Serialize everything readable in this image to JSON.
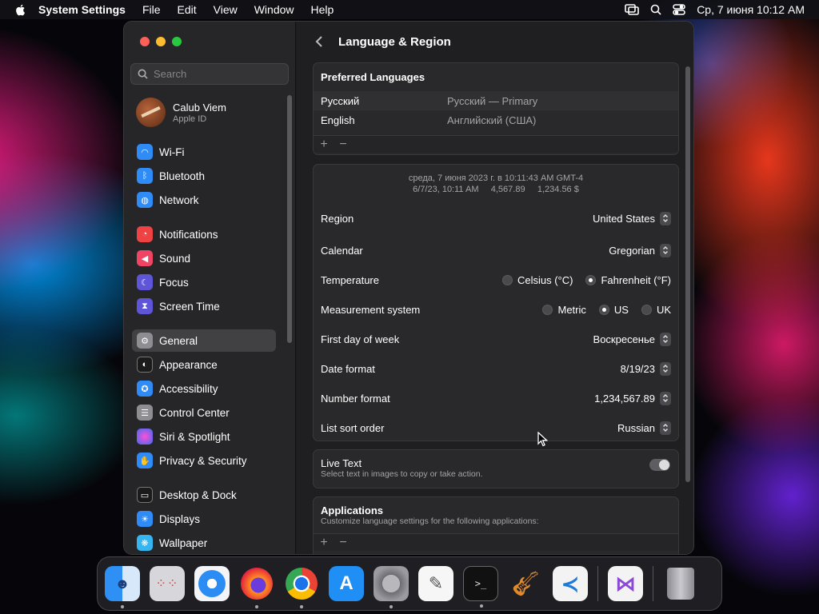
{
  "menubar": {
    "app": "System Settings",
    "menus": [
      "File",
      "Edit",
      "View",
      "Window",
      "Help"
    ],
    "clock": "Ср, 7 июня  10:12 AM"
  },
  "sidebar": {
    "search_placeholder": "Search",
    "profile": {
      "name": "Calub Viem",
      "subtitle": "Apple ID"
    },
    "items": [
      {
        "label": "Wi-Fi",
        "icon": "wifi-icon",
        "color": "#2f8cf6"
      },
      {
        "label": "Bluetooth",
        "icon": "bluetooth-icon",
        "color": "#2f8cf6"
      },
      {
        "label": "Network",
        "icon": "globe-icon",
        "color": "#2f8cf6"
      },
      {
        "label": "Notifications",
        "icon": "bell-icon",
        "color": "#ef4343"
      },
      {
        "label": "Sound",
        "icon": "speaker-icon",
        "color": "#ef4463"
      },
      {
        "label": "Focus",
        "icon": "moon-icon",
        "color": "#5e55d8"
      },
      {
        "label": "Screen Time",
        "icon": "hourglass-icon",
        "color": "#5e55d8"
      },
      {
        "label": "General",
        "icon": "gear-icon",
        "color": "#8d8d92"
      },
      {
        "label": "Appearance",
        "icon": "appearance-icon",
        "color": "#1b1b1b"
      },
      {
        "label": "Accessibility",
        "icon": "accessibility-icon",
        "color": "#2f8cf6"
      },
      {
        "label": "Control Center",
        "icon": "control-center-icon",
        "color": "#8d8d92"
      },
      {
        "label": "Siri & Spotlight",
        "icon": "siri-icon",
        "color": "#c04fd8"
      },
      {
        "label": "Privacy & Security",
        "icon": "hand-icon",
        "color": "#2f8cf6"
      },
      {
        "label": "Desktop & Dock",
        "icon": "dock-icon",
        "color": "#1b1b1b"
      },
      {
        "label": "Displays",
        "icon": "sun-icon",
        "color": "#2f8cf6"
      },
      {
        "label": "Wallpaper",
        "icon": "wallpaper-icon",
        "color": "#35b6f0"
      }
    ]
  },
  "content": {
    "title": "Language & Region",
    "preferred": {
      "header": "Preferred Languages",
      "languages": [
        {
          "name": "Русский",
          "value": "Русский — Primary"
        },
        {
          "name": "English",
          "value": "Английский (США)"
        }
      ],
      "add": "+",
      "remove": "−"
    },
    "preview": {
      "line1": "среда, 7 июня 2023 г. в 10:11:43 AM GMT-4",
      "line2": "6/7/23, 10:11 AM     4,567.89     1,234.56 $"
    },
    "settings": {
      "region": {
        "label": "Region",
        "value": "United States"
      },
      "calendar": {
        "label": "Calendar",
        "value": "Gregorian"
      },
      "temperature": {
        "label": "Temperature",
        "options": [
          "Celsius (°C)",
          "Fahrenheit (°F)"
        ],
        "selected": "Fahrenheit (°F)"
      },
      "measurement": {
        "label": "Measurement system",
        "options": [
          "Metric",
          "US",
          "UK"
        ],
        "selected": "US"
      },
      "first_day": {
        "label": "First day of week",
        "value": "Воскресенье"
      },
      "date_format": {
        "label": "Date format",
        "value": "8/19/23"
      },
      "number_format": {
        "label": "Number format",
        "value": "1,234,567.89"
      },
      "sort_order": {
        "label": "List sort order",
        "value": "Russian"
      }
    },
    "live_text": {
      "label": "Live Text",
      "description": "Select text in images to copy or take action.",
      "enabled": true
    },
    "applications": {
      "header": "Applications",
      "description": "Customize language settings for the following applications:",
      "add": "+",
      "remove": "−"
    }
  },
  "dock": {
    "apps": [
      "Finder",
      "Launchpad",
      "Safari",
      "Firefox",
      "Google Chrome",
      "App Store",
      "System Settings",
      "TextEdit",
      "Terminal",
      "GarageBand",
      "Visual Studio Code",
      "Visual Studio",
      "Trash"
    ]
  }
}
